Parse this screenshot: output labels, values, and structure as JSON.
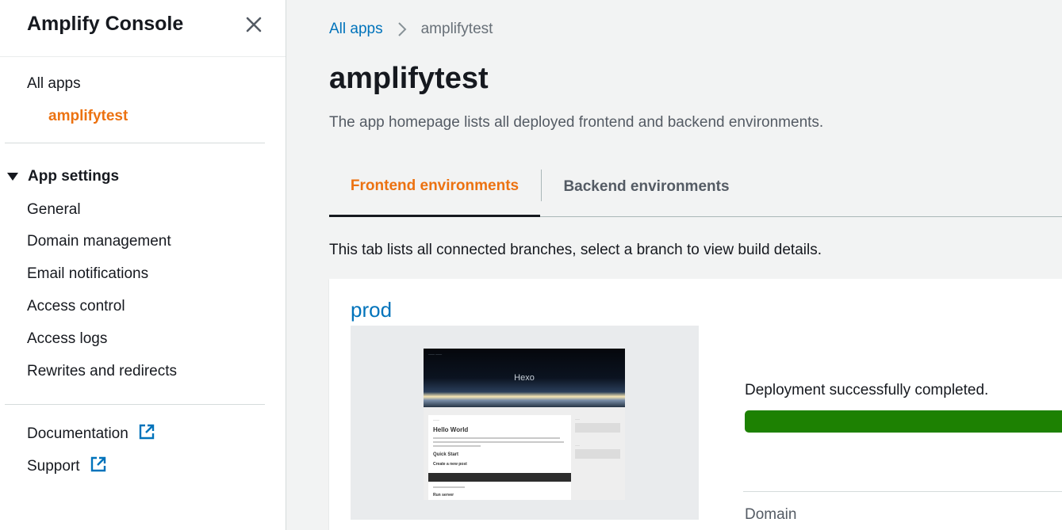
{
  "sidebar": {
    "title": "Amplify Console",
    "all_apps": "All apps",
    "current_app": "amplifytest",
    "section_title": "App settings",
    "settings_items": [
      {
        "label": "General"
      },
      {
        "label": "Domain management"
      },
      {
        "label": "Email notifications"
      },
      {
        "label": "Access control"
      },
      {
        "label": "Access logs"
      },
      {
        "label": "Rewrites and redirects"
      }
    ],
    "documentation": "Documentation",
    "support": "Support"
  },
  "breadcrumb": {
    "root": "All apps",
    "current": "amplifytest"
  },
  "page": {
    "title": "amplifytest",
    "description": "The app homepage lists all deployed frontend and backend environments."
  },
  "tabs": [
    {
      "label": "Frontend environments",
      "active": true
    },
    {
      "label": "Backend environments",
      "active": false
    }
  ],
  "tab_description": "This tab lists all connected branches, select a branch to view build details.",
  "branch": {
    "name": "prod",
    "preview": {
      "site_title": "Hexo",
      "post_title": "Hello World",
      "section_1": "Quick Start",
      "section_2": "Create a new post",
      "section_3": "Run server"
    },
    "status_text": "Deployment successfully completed.",
    "progress_percent": 100,
    "domain_label": "Domain"
  },
  "colors": {
    "accent": "#ec7211",
    "link": "#0073bb",
    "success": "#1d8102"
  }
}
